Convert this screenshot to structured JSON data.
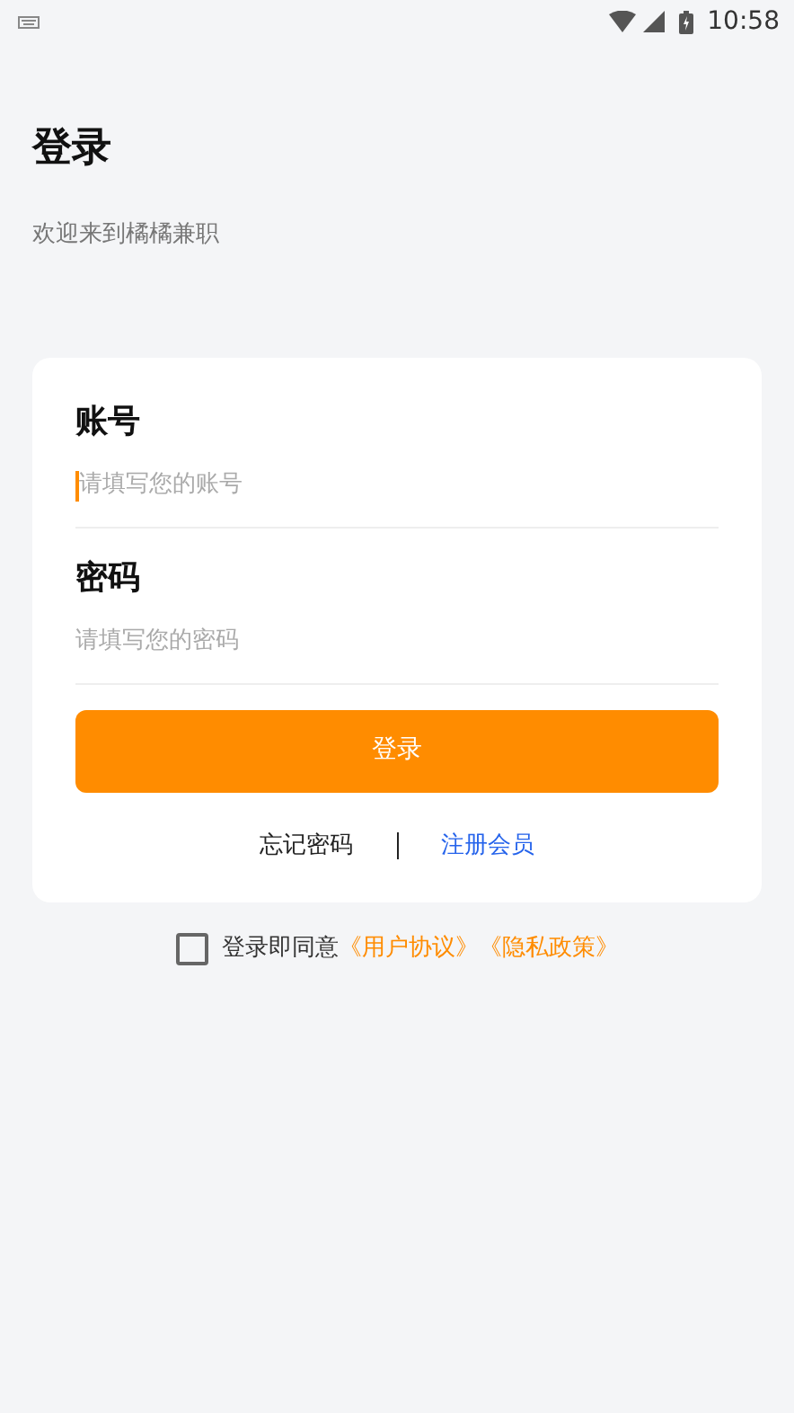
{
  "status_bar": {
    "time": "10:58"
  },
  "title": "登录",
  "subtitle": "欢迎来到橘橘兼职",
  "fields": [
    {
      "label": "账号",
      "placeholder": "请填写您的账号",
      "focused": true
    },
    {
      "label": "密码",
      "placeholder": "请填写您的密码",
      "focused": false
    }
  ],
  "login_button": "登录",
  "links": [
    {
      "text": "忘记密码",
      "kind": "plain"
    },
    {
      "text": "注册会员",
      "kind": "link"
    }
  ],
  "agreement": {
    "checked": false,
    "text": "登录即同意",
    "links": [
      "《用户协议》",
      "《隐私政策》"
    ]
  }
}
